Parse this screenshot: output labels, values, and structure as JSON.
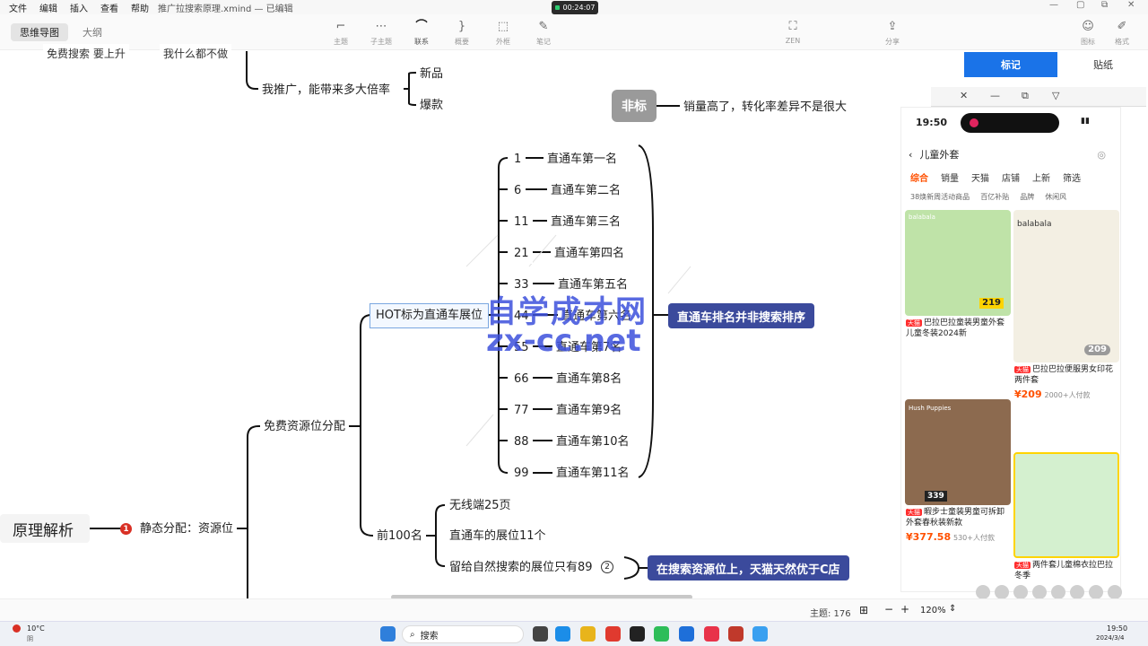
{
  "menubar": {
    "items": [
      "文件",
      "编辑",
      "插入",
      "查看",
      "帮助"
    ],
    "document": "推广拉搜索原理.xmind — 已编辑"
  },
  "recorder": {
    "time": "00:24:07"
  },
  "toolbar": {
    "view_tabs": [
      "思维导图",
      "大纲"
    ],
    "tools": [
      {
        "label": "主题",
        "icon": "topic-icon"
      },
      {
        "label": "子主题",
        "icon": "subtopic-icon"
      },
      {
        "label": "联系",
        "icon": "relationship-icon"
      },
      {
        "label": "概要",
        "icon": "summary-icon"
      },
      {
        "label": "外框",
        "icon": "boundary-icon"
      },
      {
        "label": "笔记",
        "icon": "note-icon"
      },
      {
        "label": "ZEN",
        "icon": "zen-icon"
      },
      {
        "label": "分享",
        "icon": "share-icon"
      },
      {
        "label": "图标",
        "icon": "sticker-icon"
      },
      {
        "label": "格式",
        "icon": "format-icon"
      }
    ]
  },
  "side_panel": {
    "tabs": [
      "标记",
      "贴纸"
    ]
  },
  "mindmap": {
    "root": "原理解析",
    "static_branch": {
      "badge": "1",
      "label": "静态分配：资源位"
    },
    "top_fragment": "免费搜索 要上升",
    "top_fragment2": "我什么都不做",
    "promo_question": "我推广，能带来多大倍率",
    "promo_children": [
      "新品",
      "爆款"
    ],
    "callout_gray": "非标",
    "callout_gray_text": "销量高了，转化率差异不是很大",
    "free_branch": "免费资源位分配",
    "hot_node": "HOT标为直通车展位",
    "positions": [
      {
        "num": "1",
        "label": "直通车第一名"
      },
      {
        "num": "6",
        "label": "直通车第二名"
      },
      {
        "num": "11",
        "label": "直通车第三名"
      },
      {
        "num": "21",
        "label": "直通车第四名"
      },
      {
        "num": "33",
        "label": "直通车第五名"
      },
      {
        "num": "44",
        "label": "直通车第六名"
      },
      {
        "num": "55",
        "label": "直通车第7名"
      },
      {
        "num": "66",
        "label": "直通车第8名"
      },
      {
        "num": "77",
        "label": "直通车第9名"
      },
      {
        "num": "88",
        "label": "直通车第10名"
      },
      {
        "num": "99",
        "label": "直通车第11名"
      }
    ],
    "summary_tag": "直通车排名并非搜索排序",
    "top100": "前100名",
    "top100_children": [
      "无线端25页",
      "直通车的展位11个",
      "留给自然搜索的展位只有89"
    ],
    "top100_circle": "2",
    "summary_tag2": "在搜索资源位上，天猫天然优于C店"
  },
  "watermark": {
    "line1": "自学成才网",
    "line2": "zx-cc.net"
  },
  "phone": {
    "time": "19:50",
    "search_text": "儿童外套",
    "sort_tabs": [
      "综合",
      "销量",
      "天猫",
      "店铺",
      "上新",
      "筛选"
    ],
    "chips": [
      "38焕新周活动商品",
      "百亿补贴",
      "品牌",
      "休闲风"
    ],
    "cards": [
      {
        "brand": "balabala",
        "price_tag": "219",
        "title": "巴拉巴拉童装男童外套儿童冬装2024新",
        "tmall": "天猫",
        "color": "#bfe3a8"
      },
      {
        "brand": "balabala",
        "price_tag": "209",
        "title": "巴拉巴拉便服男女印花两件套",
        "tmall": "天猫",
        "price": "¥209",
        "meta": "2000+人付款",
        "color": "#f3efe3"
      },
      {
        "brand": "Hush Puppies",
        "price_tag": "339",
        "title": "暇步士童装男童可拆卸外套春秋装新款",
        "tmall": "天猫",
        "price": "¥377.58",
        "meta": "530+人付款",
        "color": "#8c6a4f"
      },
      {
        "brand": "",
        "price_tag": "",
        "title": "两件套儿童棉衣拉巴拉冬季",
        "tmall": "天猫",
        "color": "#d4f0cf"
      }
    ]
  },
  "statusbar": {
    "topics": "主题: 176",
    "zoom": "120%"
  },
  "taskbar": {
    "weather": "10°C",
    "weather_sub": "阴",
    "search": "搜索",
    "time": "19:50",
    "date": "2024/3/4"
  }
}
